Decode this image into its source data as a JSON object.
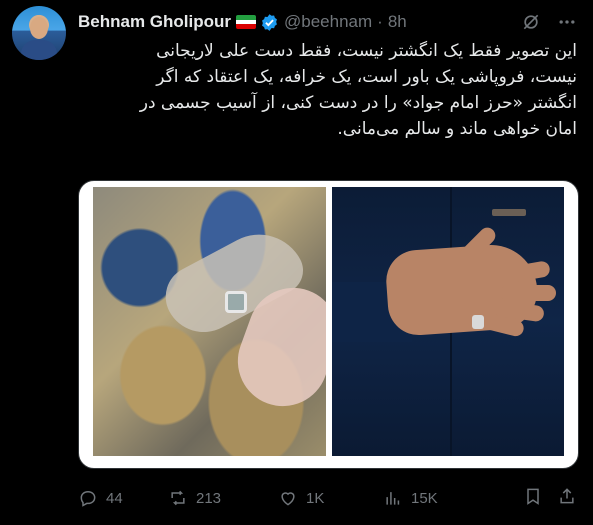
{
  "author": {
    "name": "Behnam Gholipour",
    "handle": "@beehnam",
    "separator": "·",
    "time": "8h"
  },
  "tweet": {
    "lines": [
      "این تصویر فقط یک انگشتر نیست، فقط دست علی لاریجانی",
      "نیست، فروپاشی یک  باور است، یک خرافه، یک اعتقاد که اگر",
      "انگشتر «حرز امام جواد» را در دست  کنی، از آسیب جسمی در",
      "امان خواهی ماند و سالم می‌مانی."
    ]
  },
  "metrics": {
    "replies": "44",
    "retweets": "213",
    "likes": "1K",
    "views": "15K"
  },
  "colors": {
    "accent": "#1d9bf0",
    "muted": "#71767b",
    "text": "#e7e9ea"
  },
  "icons": {
    "verified": "verified-badge-icon",
    "grok": "grok-icon",
    "more": "more-icon",
    "reply": "reply-icon",
    "retweet": "retweet-icon",
    "like": "like-icon",
    "views": "views-icon",
    "bookmark": "bookmark-icon",
    "share": "share-icon"
  }
}
